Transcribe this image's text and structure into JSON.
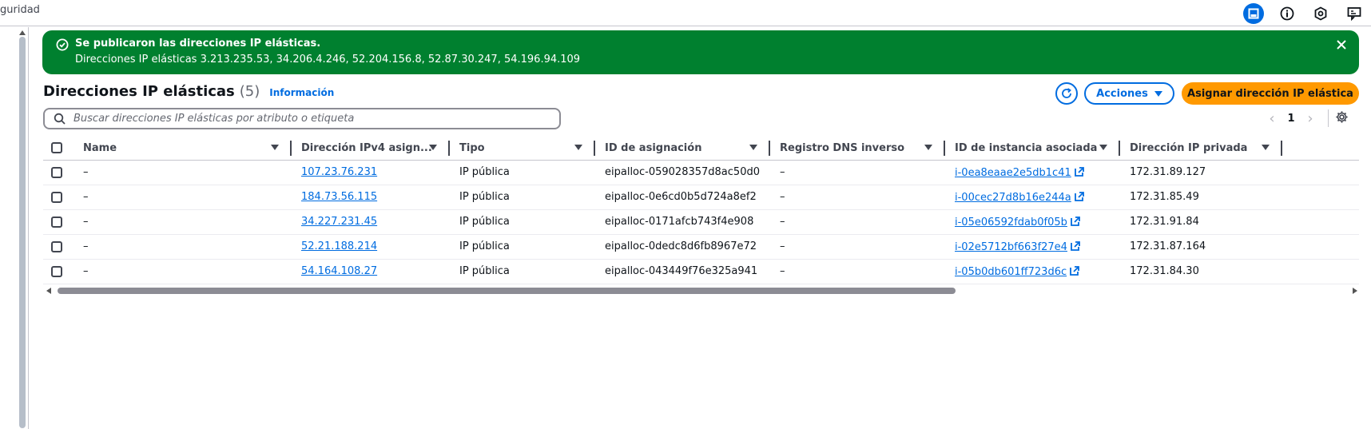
{
  "topbar": {
    "crumb": "guridad",
    "icons": [
      "panel-icon",
      "info-icon",
      "cloudshell-hex-icon",
      "feedback-icon"
    ]
  },
  "flash": {
    "title": "Se publicaron las direcciones IP elásticas.",
    "body": "Direcciones IP elásticas 3.213.235.53, 34.206.4.246, 52.204.156.8, 52.87.30.247, 54.196.94.109",
    "color": "#00802f"
  },
  "header": {
    "title": "Direcciones IP elásticas",
    "count": "(5)",
    "info": "Información",
    "actions_label": "Acciones",
    "assign_label": "Asignar dirección IP elástica"
  },
  "search": {
    "placeholder": "Buscar direcciones IP elásticas por atributo o etiqueta",
    "value": ""
  },
  "pager": {
    "page": "1"
  },
  "table": {
    "columns": [
      "Name",
      "Dirección IPv4 asign...",
      "Tipo",
      "ID de asignación",
      "Registro DNS inverso",
      "ID de instancia asociada",
      "Dirección IP privada"
    ],
    "rows": [
      {
        "name": "–",
        "ip": "107.23.76.231",
        "type": "IP pública",
        "alloc": "eipalloc-059028357d8ac50d0",
        "dns": "–",
        "instance": "i-0ea8eaae2e5db1c41",
        "private": "172.31.89.127"
      },
      {
        "name": "–",
        "ip": "184.73.56.115",
        "type": "IP pública",
        "alloc": "eipalloc-0e6cd0b5d724a8ef2",
        "dns": "–",
        "instance": "i-00cec27d8b16e244a",
        "private": "172.31.85.49"
      },
      {
        "name": "–",
        "ip": "34.227.231.45",
        "type": "IP pública",
        "alloc": "eipalloc-0171afcb743f4e908",
        "dns": "–",
        "instance": "i-05e06592fdab0f05b",
        "private": "172.31.91.84"
      },
      {
        "name": "–",
        "ip": "52.21.188.214",
        "type": "IP pública",
        "alloc": "eipalloc-0dedc8d6fb8967e72",
        "dns": "–",
        "instance": "i-02e5712bf663f27e4",
        "private": "172.31.87.164"
      },
      {
        "name": "–",
        "ip": "54.164.108.27",
        "type": "IP pública",
        "alloc": "eipalloc-043449f76e325a941",
        "dns": "–",
        "instance": "i-05b0db601ff723d6c",
        "private": "172.31.84.30"
      }
    ]
  },
  "colors": {
    "link": "#006ce0",
    "primary_button": "#ff9900",
    "flash_success": "#00802f"
  }
}
